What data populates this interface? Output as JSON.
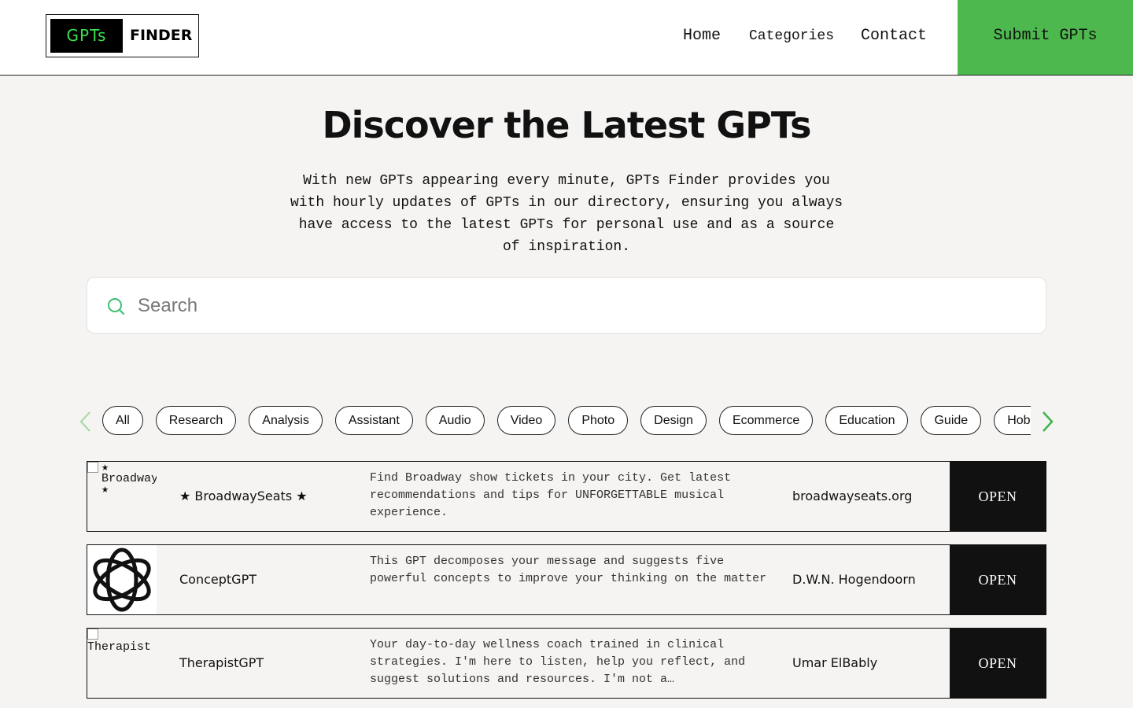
{
  "header": {
    "logo": {
      "left": "GPTs",
      "right": "FINDER"
    },
    "nav": {
      "home": "Home",
      "categories": "Categories",
      "contact": "Contact"
    },
    "submit_label": "Submit GPTs",
    "accent_color": "#4cb84d"
  },
  "hero": {
    "title": "Discover the Latest GPTs",
    "description": "With new GPTs appearing every minute, GPTs Finder provides you with hourly updates of GPTs in our directory, ensuring you always have access to the latest GPTs for personal use and as a source of inspiration."
  },
  "search": {
    "placeholder": "Search",
    "value": "",
    "icon": "search-icon"
  },
  "categories": [
    "All",
    "Research",
    "Analysis",
    "Assistant",
    "Audio",
    "Video",
    "Photo",
    "Design",
    "Ecommerce",
    "Education",
    "Guide",
    "Hobby"
  ],
  "gpts": [
    {
      "image_alt": "★ BroadwayS ★",
      "name": "★ BroadwaySeats ★",
      "description": "Find Broadway show tickets in your city. Get latest recommendations and tips for UNFORGETTABLE musical experience.",
      "author": "broadwayseats.org",
      "open_label": "OPEN"
    },
    {
      "image_icon": "openai-logo-icon",
      "name": "ConceptGPT",
      "description": "This GPT decomposes your message and suggests five powerful concepts to improve your thinking on the matter",
      "author": "D.W.N. Hogendoorn",
      "open_label": "OPEN"
    },
    {
      "image_alt": "Therapist",
      "name": "TherapistGPT",
      "description": "Your day-to-day wellness coach trained in clinical strategies. I'm here to listen, help you reflect, and suggest solutions and resources. I'm not a…",
      "author": "Umar ElBably",
      "open_label": "OPEN"
    }
  ]
}
